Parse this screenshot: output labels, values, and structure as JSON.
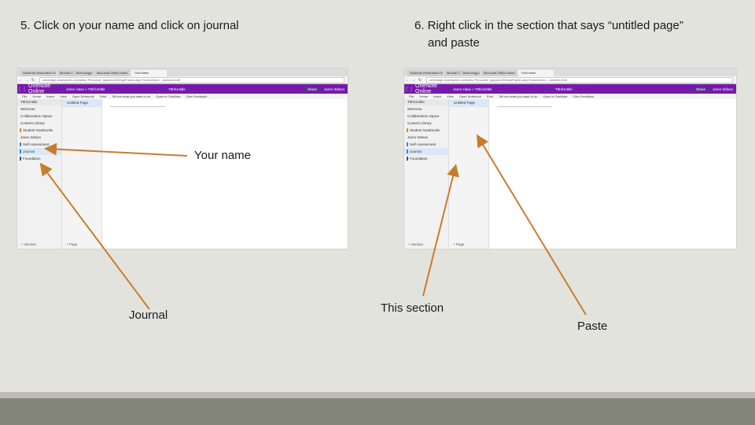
{
  "captions": {
    "left": "5. Click on your name and click on journal",
    "right_line1": "6. Right click in the section that says “untitled page”",
    "right_line2": "and paste"
  },
  "annotations": {
    "your_name": "Your name",
    "journal": "Journal",
    "this_section": "This section",
    "paste": "Paste",
    "arrow_color": "#c87d2e"
  },
  "colors": {
    "slide_bg": "#e3e3de",
    "footer": "#83847a",
    "onenote_purple": "#7719aa"
  },
  "left_screenshot": {
    "tabs": [
      "Students Reminders Fst",
      "Module 2 - Technology tech",
      "Microsoft Office Home",
      "T9h/Untitle"
    ],
    "url": "cenbridge.sharepoint.com/sites/ Personal/_layouts/15/WopiFrame.aspx?sourcedoc=...&action=edit",
    "brand": "OneNote Online",
    "breadcrumb": "Jaren Hass » T9h/Untitle",
    "notebook": "T9h/Untitle",
    "user": "Jaren Wilson",
    "share": "Share",
    "ribbon": [
      "File",
      "Home",
      "Insert",
      "View",
      "Open Notebook",
      "Print",
      "Tell me what you want to do",
      "Open in OneNote",
      "Give Feedback"
    ],
    "sections_header": "T9h/Untitle",
    "sections": [
      {
        "label": "Welcome",
        "group": true
      },
      {
        "label": "Collaboration Space",
        "group": true
      },
      {
        "label": "Content Library",
        "group": true
      },
      {
        "label": "Student Notebooks",
        "tag": "#d98a2b"
      },
      {
        "label": "Jaren Wilson",
        "group": true
      },
      {
        "label": "Self Assessment",
        "tag": "#2e8bc0"
      },
      {
        "label": "Journal",
        "tag": "#2e8bc0",
        "selected": true
      },
      {
        "label": "Foundation",
        "tag": "#3b4fa0"
      }
    ],
    "pages": [
      {
        "label": "Untitled Page",
        "selected": true
      }
    ],
    "section_footer": "+ Section",
    "page_footer": "+ Page"
  },
  "right_screenshot": {
    "tabs": [
      "Students Reminders Fst",
      "Module 2 - Technology tech",
      "Microsoft Office Home",
      "T9h/Untitle"
    ],
    "url": "cenbridge.sharepoint.com/sites/ Personal/_layouts/15/WopiFrame.aspx?sourcedoc=...&action=edit",
    "brand": "OneNote Online",
    "breadcrumb": "Jaren Hass » T9h/Untitle",
    "notebook": "T9h/Untitle",
    "user": "Jaren Wilson",
    "share": "Share",
    "ribbon": [
      "File",
      "Home",
      "Insert",
      "View",
      "Open Notebook",
      "Print",
      "Tell me what you want to do",
      "Open in OneNote",
      "Give Feedback"
    ],
    "sections_header": "T9h/Untitle",
    "sections": [
      {
        "label": "Welcome",
        "group": true
      },
      {
        "label": "Collaboration Space",
        "group": true
      },
      {
        "label": "Content Library",
        "group": true
      },
      {
        "label": "Student Notebooks",
        "tag": "#d98a2b"
      },
      {
        "label": "Jaren Wilson",
        "group": true
      },
      {
        "label": "Self Assessment",
        "tag": "#2e8bc0"
      },
      {
        "label": "Journal",
        "tag": "#2e8bc0",
        "selected": true
      },
      {
        "label": "Foundation",
        "tag": "#3b4fa0"
      }
    ],
    "pages": [
      {
        "label": "Untitled Page",
        "selected": true
      }
    ],
    "context_menu": [
      "Page",
      "Paste"
    ],
    "section_footer": "+ Section",
    "page_footer": "+ Page"
  }
}
